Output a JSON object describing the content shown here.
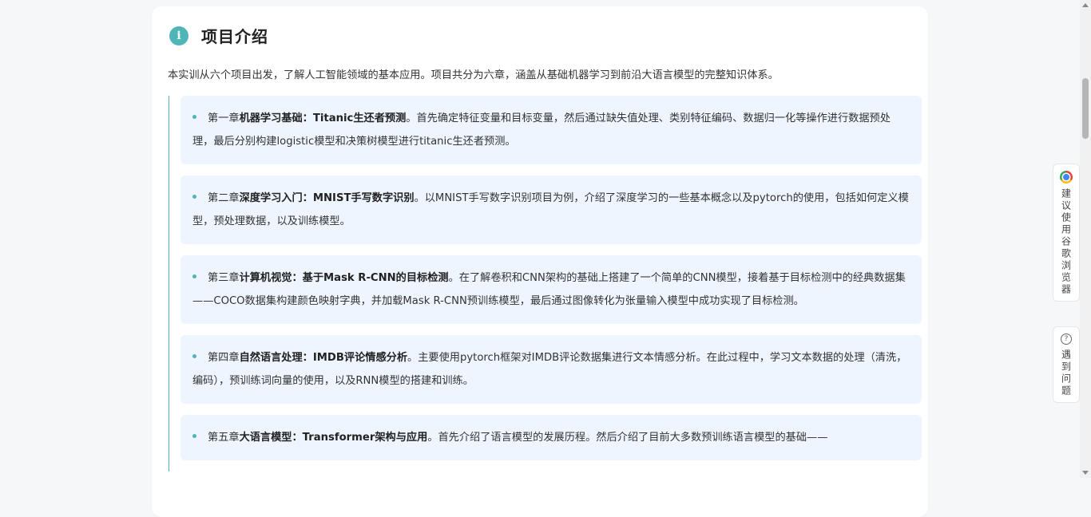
{
  "section": {
    "title": "项目介绍",
    "intro": "本实训从六个项目出发，了解人工智能领域的基本应用。项目共分为六章，涵盖从基础机器学习到前沿大语言模型的完整知识体系。"
  },
  "chapters": [
    {
      "prefix": "第一章",
      "bold": "机器学习基础：Titanic生还者预测",
      "text": "。首先确定特征变量和目标变量，然后通过缺失值处理、类别特征编码、数据归一化等操作进行数据预处理，最后分别构建logistic模型和决策树模型进行titanic生还者预测。"
    },
    {
      "prefix": "第二章",
      "bold": "深度学习入门：MNIST手写数字识别",
      "text": "。以MNIST手写数字识别项目为例，介绍了深度学习的一些基本概念以及pytorch的使用，包括如何定义模型，预处理数据，以及训练模型。"
    },
    {
      "prefix": "第三章",
      "bold": "计算机视觉：基于Mask R-CNN的目标检测",
      "text": "。在了解卷积和CNN架构的基础上搭建了一个简单的CNN模型，接着基于目标检测中的经典数据集——COCO数据集构建颜色映射字典，并加载Mask R-CNN预训练模型，最后通过图像转化为张量输入模型中成功实现了目标检测。"
    },
    {
      "prefix": "第四章",
      "bold": "自然语言处理：IMDB评论情感分析",
      "text": "。主要使用pytorch框架对IMDB评论数据集进行文本情感分析。在此过程中，学习文本数据的处理（清洗，编码），预训练词向量的使用，以及RNN模型的搭建和训练。"
    },
    {
      "prefix": "第五章",
      "bold": "大语言模型：Transformer架构与应用",
      "text": "。首先介绍了语言模型的发展历程。然后介绍了目前大多数预训练语言模型的基础——"
    }
  ],
  "float_buttons": {
    "chrome": {
      "icon": "chrome-icon",
      "label": "建议使用谷歌浏览器"
    },
    "help": {
      "icon": "help-circle-icon",
      "glyph": "?",
      "label": "遇到问题"
    }
  },
  "colors": {
    "accent": "#4fb5b8",
    "chapter_bg": "#eef5ff",
    "page_bg": "#f6f7f9"
  }
}
